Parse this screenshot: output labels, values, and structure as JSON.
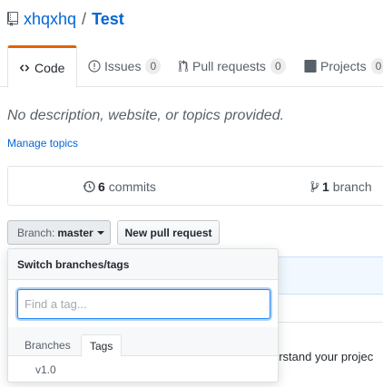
{
  "repo": {
    "owner": "xhqxhq",
    "separator": "/",
    "name": "Test"
  },
  "tabs": [
    {
      "label": "Code"
    },
    {
      "label": "Issues",
      "count": "0"
    },
    {
      "label": "Pull requests",
      "count": "0"
    },
    {
      "label": "Projects",
      "count": "0"
    }
  ],
  "description": "No description, website, or topics provided.",
  "manage_topics": "Manage topics",
  "summary": {
    "commits_count": "6",
    "commits_label": "commits",
    "branches_count": "1",
    "branches_label": "branch"
  },
  "branch_button": {
    "prefix": "Branch:",
    "value": "master"
  },
  "new_pr_button": "New pull request",
  "menu": {
    "title": "Switch branches/tags",
    "filter_placeholder": "Find a tag...",
    "filter_value": "",
    "tabs": [
      "Branches",
      "Tags"
    ],
    "items": [
      "v1.0"
    ]
  },
  "background_text": "erstand your projec",
  "colors": {
    "link": "#0366d6",
    "tab_accent": "#e36209",
    "focus": "#2188ff"
  },
  "icons": [
    "repo-icon",
    "code-icon",
    "issue-icon",
    "pull-request-icon",
    "project-icon",
    "history-icon",
    "branch-icon"
  ]
}
